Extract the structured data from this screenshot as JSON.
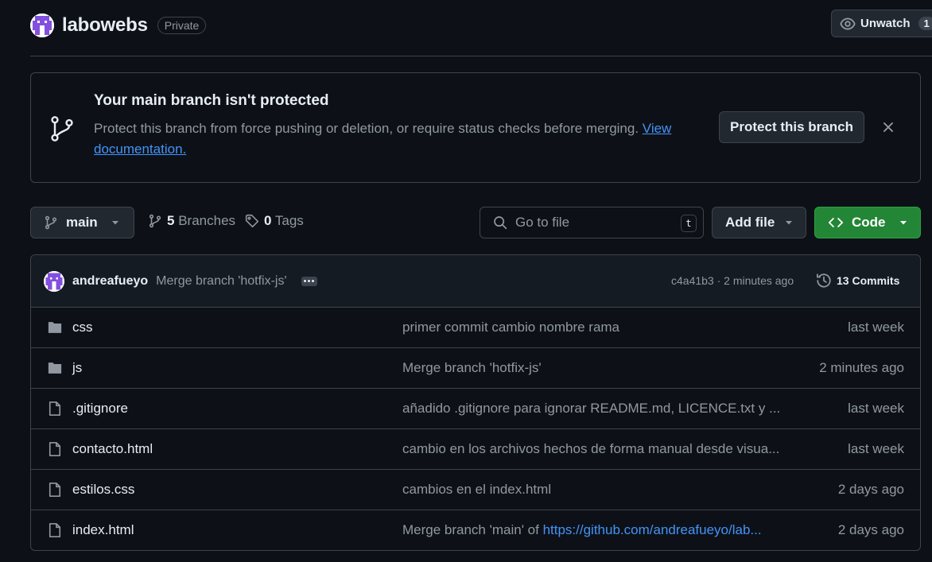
{
  "repo": {
    "name": "labowebs",
    "visibility": "Private",
    "unwatch_label": "Unwatch",
    "watch_count": "1"
  },
  "banner": {
    "title": "Your main branch isn't protected",
    "text": "Protect this branch from force pushing or deletion, or require status checks before merging. ",
    "link": "View documentation.",
    "button": "Protect this branch"
  },
  "toolbar": {
    "branch": "main",
    "branches_count": "5",
    "branches_label": "Branches",
    "tags_count": "0",
    "tags_label": "Tags",
    "search_placeholder": "Go to file",
    "search_shortcut": "t",
    "add_file": "Add file",
    "code": "Code"
  },
  "latest_commit": {
    "author": "andreafueyo",
    "message": "Merge branch 'hotfix-js'",
    "meta": "c4a41b3 · 2 minutes ago",
    "commits_label": "13 Commits"
  },
  "files": [
    {
      "type": "folder",
      "name": "css",
      "message": "primer commit cambio nombre rama",
      "date": "last week"
    },
    {
      "type": "folder",
      "name": "js",
      "message": "Merge branch 'hotfix-js'",
      "date": "2 minutes ago"
    },
    {
      "type": "file",
      "name": ".gitignore",
      "message": "añadido .gitignore para ignorar README.md, LICENCE.txt y ...",
      "date": "last week"
    },
    {
      "type": "file",
      "name": "contacto.html",
      "message": "cambio en los archivos hechos de forma manual desde visua...",
      "date": "last week"
    },
    {
      "type": "file",
      "name": "estilos.css",
      "message": "cambios en el index.html",
      "date": "2 days ago"
    },
    {
      "type": "file",
      "name": "index.html",
      "message": "Merge branch 'main' of ",
      "message_link": "https://github.com/andreafueyo/lab...",
      "date": "2 days ago"
    }
  ],
  "colors": {
    "background": "#0d1117",
    "border": "#3d444d",
    "muted_text": "#9198a1",
    "link": "#4493f8",
    "code_button": "#238636",
    "avatar_purple": "#8250df"
  }
}
